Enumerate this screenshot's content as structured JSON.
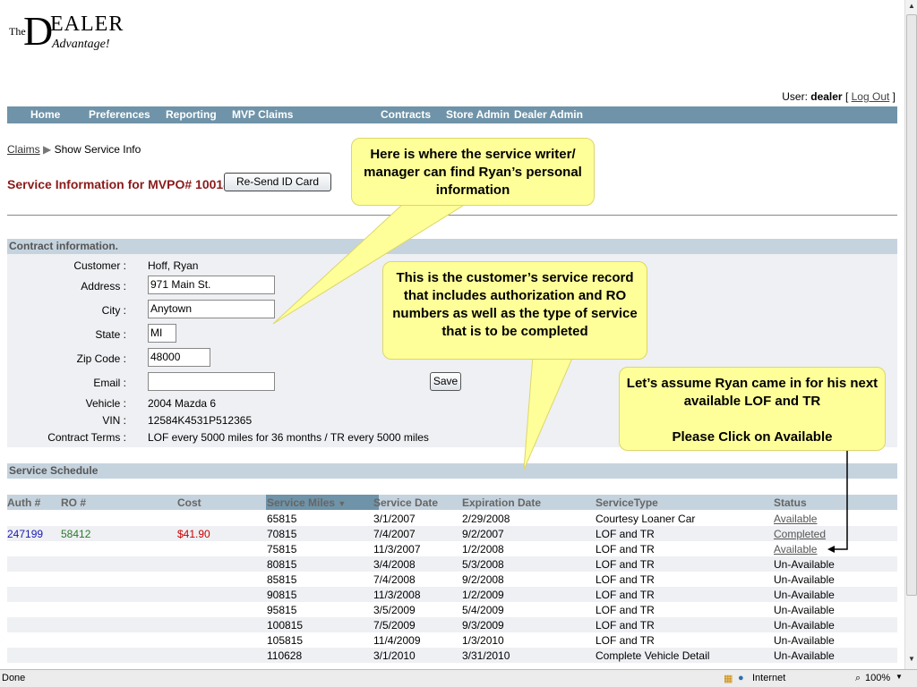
{
  "logo": {
    "the": "The",
    "d": "D",
    "ealer": "EALER",
    "advantage": "Advantage!"
  },
  "user": {
    "label": "User:",
    "name": "dealer",
    "logout": "Log Out"
  },
  "nav": [
    "Home",
    "Preferences",
    "Reporting",
    "MVP Claims",
    "Contracts",
    "Store Admin",
    "Dealer Admin"
  ],
  "breadcrumb": {
    "link": "Claims",
    "current": "Show Service Info"
  },
  "service_title": "Service Information for MVPO# 10018",
  "resend_button": "Re-Send ID Card",
  "contract_section": "Contract information.",
  "contract": {
    "customer_label": "Customer :",
    "customer": "Hoff, Ryan",
    "address_label": "Address :",
    "address": "971 Main St.",
    "city_label": "City :",
    "city": "Anytown",
    "state_label": "State :",
    "state": "MI",
    "zip_label": "Zip Code :",
    "zip": "48000",
    "email_label": "Email :",
    "email": "",
    "vehicle_label": "Vehicle :",
    "vehicle": "2004 Mazda 6",
    "vin_label": "VIN :",
    "vin": "12584K4531P512365",
    "terms_label": "Contract Terms :",
    "terms": "LOF every 5000 miles for 36 months / TR every 5000 miles"
  },
  "save_button": "Save",
  "schedule_section": "Service Schedule",
  "table": {
    "headers": [
      "Auth #",
      "RO #",
      "Cost",
      "Service Miles",
      "Service Date",
      "Expiration Date",
      "ServiceType",
      "Status"
    ],
    "rows": [
      [
        "",
        "",
        "",
        "65815",
        "3/1/2007",
        "2/29/2008",
        "Courtesy Loaner Car",
        "Available"
      ],
      [
        "247199",
        "58412",
        "$41.90",
        "70815",
        "7/4/2007",
        "9/2/2007",
        "LOF and TR",
        "Completed"
      ],
      [
        "",
        "",
        "",
        "75815",
        "11/3/2007",
        "1/2/2008",
        "LOF and TR",
        "Available"
      ],
      [
        "",
        "",
        "",
        "80815",
        "3/4/2008",
        "5/3/2008",
        "LOF and TR",
        "Un-Available"
      ],
      [
        "",
        "",
        "",
        "85815",
        "7/4/2008",
        "9/2/2008",
        "LOF and TR",
        "Un-Available"
      ],
      [
        "",
        "",
        "",
        "90815",
        "11/3/2008",
        "1/2/2009",
        "LOF and TR",
        "Un-Available"
      ],
      [
        "",
        "",
        "",
        "95815",
        "3/5/2009",
        "5/4/2009",
        "LOF and TR",
        "Un-Available"
      ],
      [
        "",
        "",
        "",
        "100815",
        "7/5/2009",
        "9/3/2009",
        "LOF and TR",
        "Un-Available"
      ],
      [
        "",
        "",
        "",
        "105815",
        "11/4/2009",
        "1/3/2010",
        "LOF and TR",
        "Un-Available"
      ],
      [
        "",
        "",
        "",
        "110628",
        "3/1/2010",
        "3/31/2010",
        "Complete Vehicle Detail",
        "Un-Available"
      ]
    ]
  },
  "callouts": {
    "one": "Here is where the service writer/ manager can find Ryan’s personal information",
    "two": "This is the customer’s service record that includes authorization and RO numbers as well as the type of service that is to be completed",
    "three_a": "Let’s assume Ryan came in for his next available LOF and TR",
    "three_b": "Please Click on Available"
  },
  "statusbar": {
    "left": "Done",
    "zone": "Internet",
    "zoom": "100%"
  },
  "colors": {
    "nav": "#6f93a8",
    "section": "#c5d3de",
    "title": "#8b1a1a",
    "auth_blue": "#1a1ab0",
    "ro_green": "#2a7a2a",
    "cost_red": "#cc0000",
    "callout": "#ffff99"
  }
}
